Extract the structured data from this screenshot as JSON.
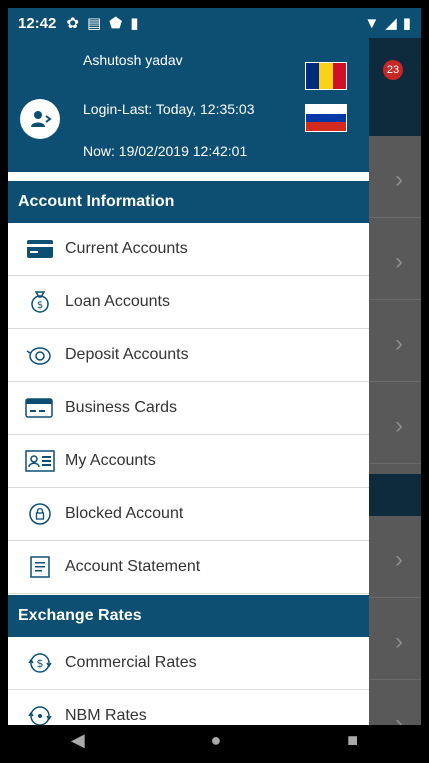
{
  "status_bar": {
    "time": "12:42"
  },
  "header": {
    "user_name": "Ashutosh  yadav",
    "login_last": "Login-Last: Today, 12:35:03",
    "now": "Now: 19/02/2019 12:42:01"
  },
  "sections": {
    "account_info": {
      "title": "Account Information",
      "items": [
        {
          "label": "Current Accounts",
          "icon": "credit-card-icon"
        },
        {
          "label": "Loan Accounts",
          "icon": "money-bag-icon"
        },
        {
          "label": "Deposit Accounts",
          "icon": "piggy-bank-icon"
        },
        {
          "label": "Business Cards",
          "icon": "business-card-icon"
        },
        {
          "label": "My Accounts",
          "icon": "id-card-icon"
        },
        {
          "label": "Blocked Account",
          "icon": "lock-icon"
        },
        {
          "label": "Account Statement",
          "icon": "statement-icon"
        }
      ]
    },
    "exchange_rates": {
      "title": "Exchange Rates",
      "items": [
        {
          "label": "Commercial Rates",
          "icon": "currency-exchange-icon"
        },
        {
          "label": "NBM Rates",
          "icon": "exchange-icon"
        }
      ]
    }
  },
  "background": {
    "badge_count": "23"
  },
  "colors": {
    "primary": "#0d4f73",
    "dark_overlay": "#0d2b3d",
    "badge": "#c62828"
  }
}
